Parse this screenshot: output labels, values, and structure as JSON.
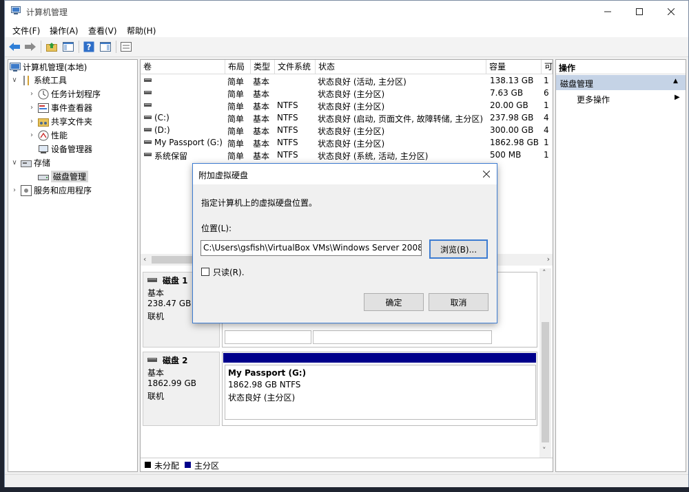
{
  "window": {
    "title": "计算机管理"
  },
  "menu": [
    "文件(F)",
    "操作(A)",
    "查看(V)",
    "帮助(H)"
  ],
  "tree": {
    "root": "计算机管理(本地)",
    "system_tools": "系统工具",
    "task_scheduler": "任务计划程序",
    "event_viewer": "事件查看器",
    "shared_folders": "共享文件夹",
    "performance": "性能",
    "device_manager": "设备管理器",
    "storage": "存储",
    "disk_management": "磁盘管理",
    "services_apps": "服务和应用程序"
  },
  "volume_table": {
    "columns": [
      "卷",
      "布局",
      "类型",
      "文件系统",
      "状态",
      "容量",
      "可"
    ],
    "rows": [
      {
        "vol": "",
        "layout": "简单",
        "type": "基本",
        "fs": "",
        "status": "状态良好 (活动, 主分区)",
        "cap": "138.13 GB",
        "free": "1"
      },
      {
        "vol": "",
        "layout": "简单",
        "type": "基本",
        "fs": "",
        "status": "状态良好 (主分区)",
        "cap": "7.63 GB",
        "free": "6"
      },
      {
        "vol": "",
        "layout": "简单",
        "type": "基本",
        "fs": "NTFS",
        "status": "状态良好 (主分区)",
        "cap": "20.00 GB",
        "free": "1"
      },
      {
        "vol": "(C:)",
        "layout": "简单",
        "type": "基本",
        "fs": "NTFS",
        "status": "状态良好 (启动, 页面文件, 故障转储, 主分区)",
        "cap": "237.98 GB",
        "free": "4"
      },
      {
        "vol": "(D:)",
        "layout": "简单",
        "type": "基本",
        "fs": "NTFS",
        "status": "状态良好 (主分区)",
        "cap": "300.00 GB",
        "free": "4"
      },
      {
        "vol": "My Passport (G:)",
        "layout": "简单",
        "type": "基本",
        "fs": "NTFS",
        "status": "状态良好 (主分区)",
        "cap": "1862.98 GB",
        "free": "1"
      },
      {
        "vol": "系统保留",
        "layout": "简单",
        "type": "基本",
        "fs": "NTFS",
        "status": "状态良好 (系统, 活动, 主分区)",
        "cap": "500 MB",
        "free": "1"
      }
    ]
  },
  "disk1": {
    "name": "磁盘 1",
    "type": "基本",
    "size": "238.47 GB",
    "state": "联机"
  },
  "disk2": {
    "name": "磁盘 2",
    "type": "基本",
    "size": "1862.99 GB",
    "state": "联机"
  },
  "partition_g": {
    "name": "My Passport  (G:)",
    "size": "1862.98 GB NTFS",
    "status": "状态良好 (主分区)"
  },
  "legend": {
    "unallocated": "未分配",
    "primary": "主分区"
  },
  "actions": {
    "title": "操作",
    "section": "磁盘管理",
    "more": "更多操作"
  },
  "dialog": {
    "title": "附加虚拟硬盘",
    "instruction": "指定计算机上的虚拟硬盘位置。",
    "location_label": "位置(L):",
    "path": "C:\\Users\\gsfish\\VirtualBox VMs\\Windows Server 2008",
    "browse": "浏览(B)...",
    "readonly": "只读(R).",
    "ok": "确定",
    "cancel": "取消"
  },
  "colors": {
    "primary_partition": "#00008b",
    "unallocated": "#000000",
    "accent": "#3c7bd1"
  }
}
